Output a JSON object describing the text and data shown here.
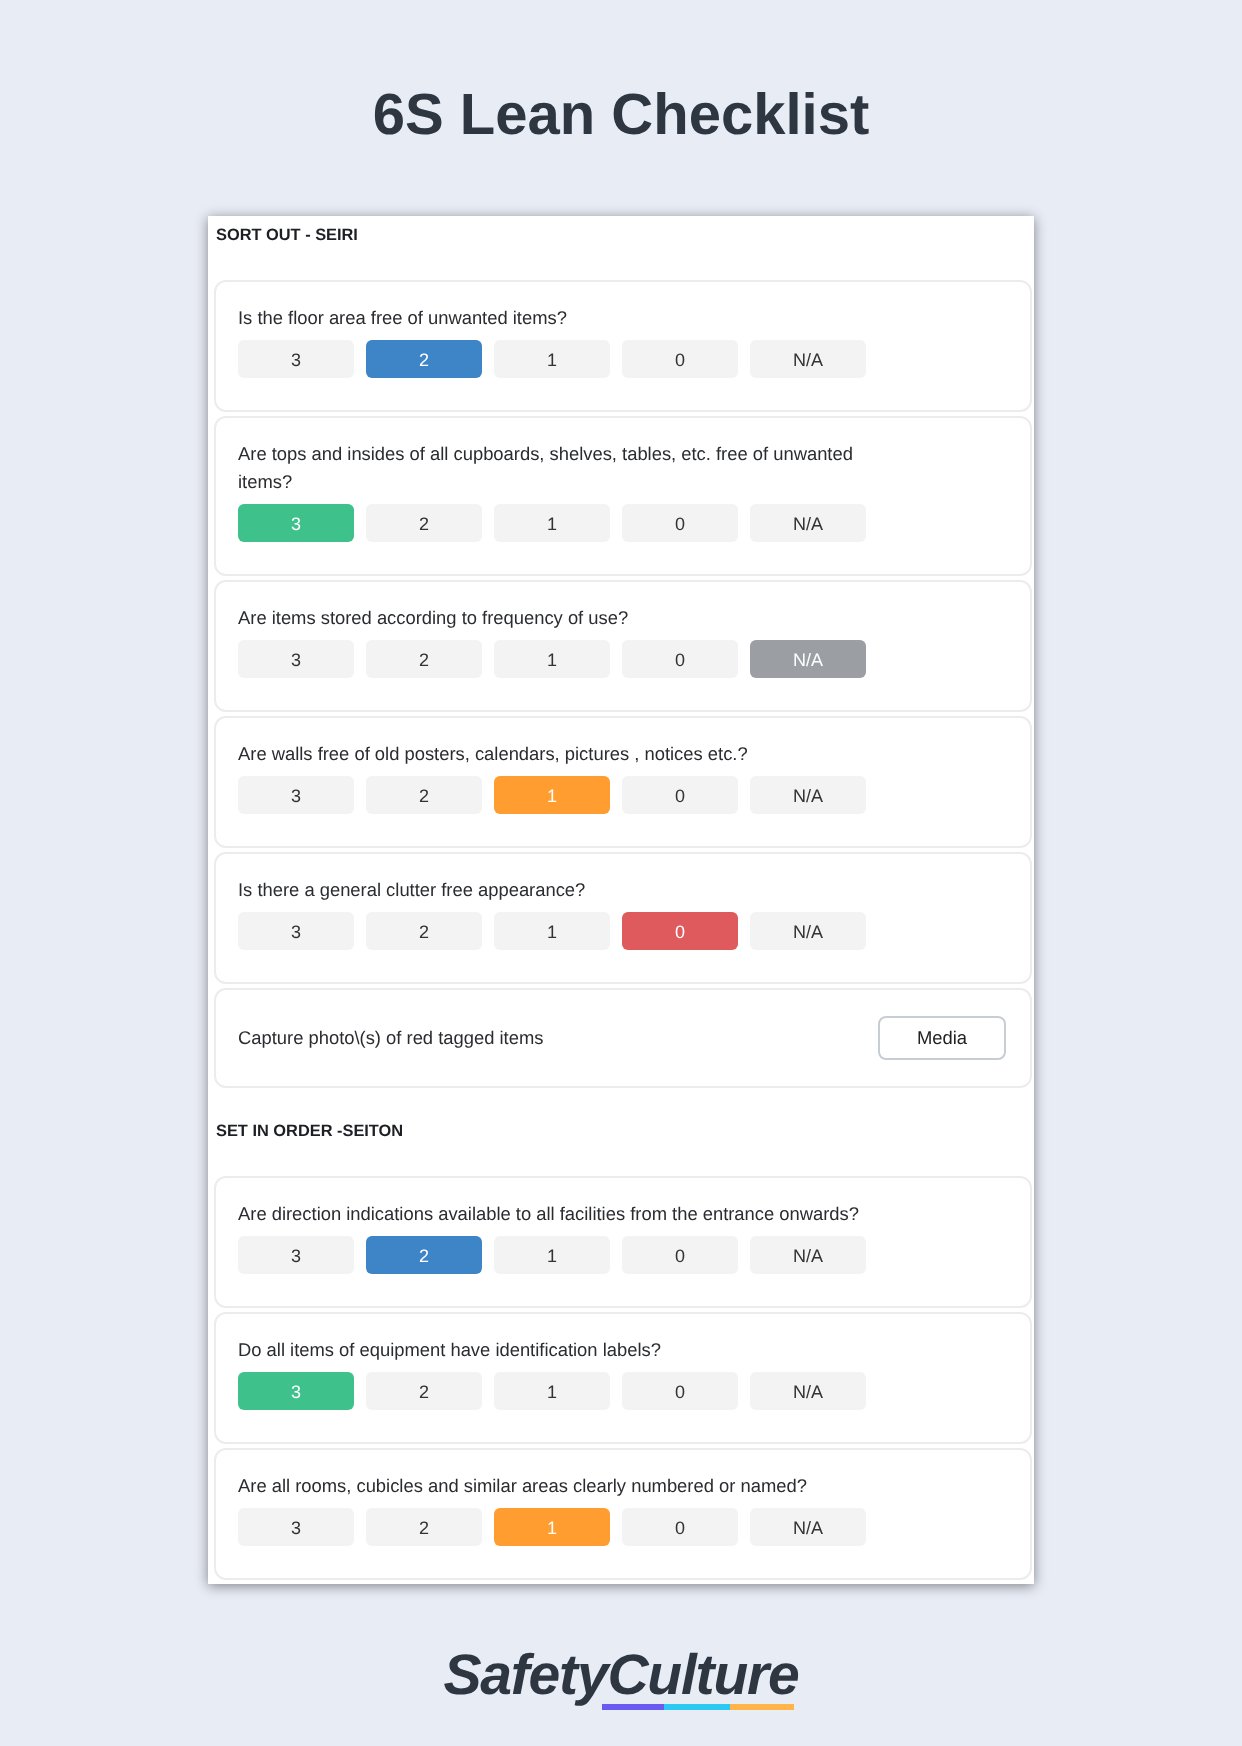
{
  "title": "6S Lean Checklist",
  "sections": [
    {
      "heading": "SORT OUT - SEIRI",
      "items": [
        {
          "kind": "score",
          "question": "Is the floor area free of unwanted items?",
          "options": [
            {
              "label": "3",
              "selected": false
            },
            {
              "label": "2",
              "selected": true
            },
            {
              "label": "1",
              "selected": false
            },
            {
              "label": "0",
              "selected": false
            },
            {
              "label": "N/A",
              "selected": false
            }
          ]
        },
        {
          "kind": "score",
          "question": "Are tops and insides of all cupboards, shelves, tables, etc. free of unwanted items?",
          "options": [
            {
              "label": "3",
              "selected": true
            },
            {
              "label": "2",
              "selected": false
            },
            {
              "label": "1",
              "selected": false
            },
            {
              "label": "0",
              "selected": false
            },
            {
              "label": "N/A",
              "selected": false
            }
          ]
        },
        {
          "kind": "score",
          "question": "Are items stored according to frequency of use?",
          "options": [
            {
              "label": "3",
              "selected": false
            },
            {
              "label": "2",
              "selected": false
            },
            {
              "label": "1",
              "selected": false
            },
            {
              "label": "0",
              "selected": false
            },
            {
              "label": "N/A",
              "selected": true
            }
          ]
        },
        {
          "kind": "score",
          "question": "Are walls free of old posters, calendars, pictures , notices etc.?",
          "options": [
            {
              "label": "3",
              "selected": false
            },
            {
              "label": "2",
              "selected": false
            },
            {
              "label": "1",
              "selected": true
            },
            {
              "label": "0",
              "selected": false
            },
            {
              "label": "N/A",
              "selected": false
            }
          ]
        },
        {
          "kind": "score",
          "question": "Is there a general clutter free appearance?",
          "options": [
            {
              "label": "3",
              "selected": false
            },
            {
              "label": "2",
              "selected": false
            },
            {
              "label": "1",
              "selected": false
            },
            {
              "label": "0",
              "selected": true
            },
            {
              "label": "N/A",
              "selected": false
            }
          ]
        },
        {
          "kind": "media",
          "label": "Capture photo\\(s) of red tagged items",
          "button": "Media"
        }
      ]
    },
    {
      "heading": "SET IN ORDER -SEITON",
      "items": [
        {
          "kind": "score",
          "question": "Are direction indications available to all facilities from the entrance onwards?",
          "options": [
            {
              "label": "3",
              "selected": false
            },
            {
              "label": "2",
              "selected": true
            },
            {
              "label": "1",
              "selected": false
            },
            {
              "label": "0",
              "selected": false
            },
            {
              "label": "N/A",
              "selected": false
            }
          ]
        },
        {
          "kind": "score",
          "question": "Do all items of equipment have identification labels?",
          "options": [
            {
              "label": "3",
              "selected": true
            },
            {
              "label": "2",
              "selected": false
            },
            {
              "label": "1",
              "selected": false
            },
            {
              "label": "0",
              "selected": false
            },
            {
              "label": "N/A",
              "selected": false
            }
          ]
        },
        {
          "kind": "score",
          "question": "Are all rooms, cubicles and similar areas clearly numbered or named?",
          "options": [
            {
              "label": "3",
              "selected": false
            },
            {
              "label": "2",
              "selected": false
            },
            {
              "label": "1",
              "selected": true
            },
            {
              "label": "0",
              "selected": false
            },
            {
              "label": "N/A",
              "selected": false
            }
          ]
        }
      ]
    }
  ],
  "logo": "SafetyCulture"
}
